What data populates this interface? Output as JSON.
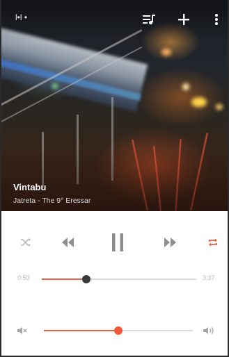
{
  "topbar": {
    "source_label": "l•l •",
    "icons": [
      "queue-music-icon",
      "add-icon",
      "more-vert-icon"
    ]
  },
  "track": {
    "title": "Vintabu",
    "subtitle": "Jatreta - The 9° Eressar"
  },
  "controls": {
    "icons": [
      "shuffle-icon",
      "previous-icon",
      "pause-icon",
      "next-icon",
      "repeat-icon"
    ],
    "repeat_active": true
  },
  "seek": {
    "elapsed": "0:53",
    "duration": "3:37",
    "progress": 0.29
  },
  "volume": {
    "level": 0.5,
    "icons": [
      "volume-down-icon",
      "volume-up-icon"
    ]
  },
  "colors": {
    "accent": "#f05a36",
    "thumb_dark": "#3a3a3a",
    "icon_gray": "#9b9b9b",
    "track_gray": "#d9d9d9"
  }
}
